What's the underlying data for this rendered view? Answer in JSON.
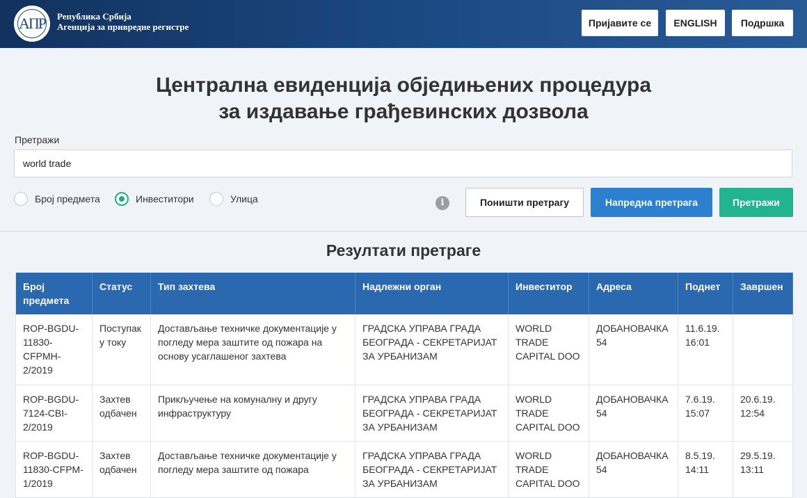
{
  "header": {
    "logo_text": "АПР",
    "org_line1": "Република Србија",
    "org_line2": "Агенција за привредне регистре",
    "login_label": "Пријавите се",
    "language_label": "ENGLISH",
    "support_label": "Подршка"
  },
  "page": {
    "title_line1": "Централна евиденција обједињених процедура",
    "title_line2": "за издавање грађевинских дозвола"
  },
  "search": {
    "label": "Претражи",
    "value": "world trade",
    "radios": [
      {
        "label": "Број предмета",
        "checked": false
      },
      {
        "label": "Инвеститори",
        "checked": true
      },
      {
        "label": "Улица",
        "checked": false
      }
    ],
    "reset_label": "Поништи претрагу",
    "advanced_label": "Напредна претрага",
    "search_label": "Претражи"
  },
  "results": {
    "title": "Резултати претраге",
    "columns": [
      "Број предмета",
      "Статус",
      "Тип захтева",
      "Надлежни орган",
      "Инвеститор",
      "Адреса",
      "Поднет",
      "Завршен"
    ],
    "rows": [
      {
        "number": "ROP-BGDU-11830-CFPMH-2/2019",
        "status": "Поступак у току",
        "type": "Достављање техничке документације у погледу мера заштите од пожара на основу усаглашеног захтева",
        "authority": "ГРАДСКА УПРАВА ГРАДА БЕОГРАДА - СЕКРЕТАРИЈАТ ЗА УРБАНИЗАМ",
        "investor": "WORLD TRADE CAPITAL DOO",
        "address": "ДОБАНОВАЧКА 54",
        "submitted": "11.6.19. 16:01",
        "finished": ""
      },
      {
        "number": "ROP-BGDU-7124-CBI-2/2019",
        "status": "Захтев одбачен",
        "type": "Прикључење на комуналну и другу инфраструктуру",
        "authority": "ГРАДСКА УПРАВА ГРАДА БЕОГРАДА - СЕКРЕТАРИЈАТ ЗА УРБАНИЗАМ",
        "investor": "WORLD TRADE CAPITAL DOO",
        "address": "ДОБАНОВАЧКА 54",
        "submitted": "7.6.19. 15:07",
        "finished": "20.6.19. 12:54"
      },
      {
        "number": "ROP-BGDU-11830-CFPM-1/2019",
        "status": "Захтев одбачен",
        "type": "Достављање техничке документације у погледу мера заштите од пожара",
        "authority": "ГРАДСКА УПРАВА ГРАДА БЕОГРАДА - СЕКРЕТАРИЈАТ ЗА УРБАНИЗАМ",
        "investor": "WORLD TRADE CAPITAL DOO",
        "address": "ДОБАНОВАЧКА 54",
        "submitted": "8.5.19. 14:11",
        "finished": "29.5.19. 13:11"
      }
    ]
  }
}
